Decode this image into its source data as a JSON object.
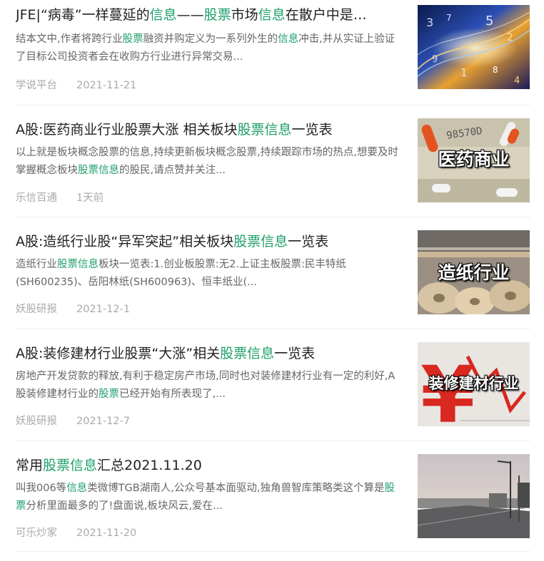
{
  "articles": [
    {
      "title_parts": [
        "JFE|“病毒”一样蔓延的",
        "信息",
        "——",
        "股票",
        "市场",
        "信息",
        "在散户中是…"
      ],
      "summary_parts": [
        "结本文中,作者将跨行业",
        "股票",
        "融资并购定义为一系列外生的",
        "信息",
        "冲击,并从实证上验证了目标公司投资者会在收购方行业进行异常交易..."
      ],
      "source": "学说平台",
      "date": "2021-11-21",
      "thumb_icon": "digital-numbers-image",
      "thumb_label": ""
    },
    {
      "title_parts": [
        "A股:医药商业行业股票大涨 相关板块",
        "股票信息",
        "一览表"
      ],
      "summary_parts": [
        "以上就是板块概念股票的信息,持续更新板块概念股票,持续跟踪市场的热点,想要及时掌握概念板块",
        "股票信息",
        "的股民,请点赞并关注..."
      ],
      "source": "乐信百通",
      "date": "1天前",
      "thumb_icon": "medicine-money-image",
      "thumb_label": "医药商业"
    },
    {
      "title_parts": [
        "A股:造纸行业股“异军突起”相关板块",
        "股票信息",
        "一览表"
      ],
      "summary_parts": [
        "造纸行业",
        "股票信息",
        "板块一览表:1.创业板股票:无2.上证主板股票:民丰特纸(SH600235)、岳阳林纸(SH600963)、恒丰纸业(..."
      ],
      "source": "妖股研报",
      "date": "2021-12-1",
      "thumb_icon": "paper-rolls-image",
      "thumb_label": "造纸行业"
    },
    {
      "title_parts": [
        "A股:装修建材行业股票“大涨”相关",
        "股票信息",
        "一览表"
      ],
      "summary_parts": [
        "房地产开发贷款的释放,有利于稳定房产市场,同时也对装修建材行业有一定的利好,A股装修建材行业的",
        "股票",
        "已经开始有所表现了,..."
      ],
      "source": "妖股研报",
      "date": "2021-12-7",
      "thumb_icon": "yuan-chart-image",
      "thumb_label": "装修建材行业"
    },
    {
      "title_parts": [
        "常用",
        "股票信息",
        "汇总2021.11.20"
      ],
      "summary_parts": [
        "叫我006等",
        "信息",
        "类微博TGB湖南人,公众号基本面驱动,独角兽智库策略类这个算是",
        "股票",
        "分析里面最多的了!盘面说,板块风云,爱在..."
      ],
      "source": "可乐炒家",
      "date": "2021-11-20",
      "thumb_icon": "road-image",
      "thumb_label": ""
    }
  ],
  "colors": {
    "highlight": "#1e9f6b",
    "title": "#222222",
    "summary": "#666666",
    "meta": "#aaaaaa"
  }
}
